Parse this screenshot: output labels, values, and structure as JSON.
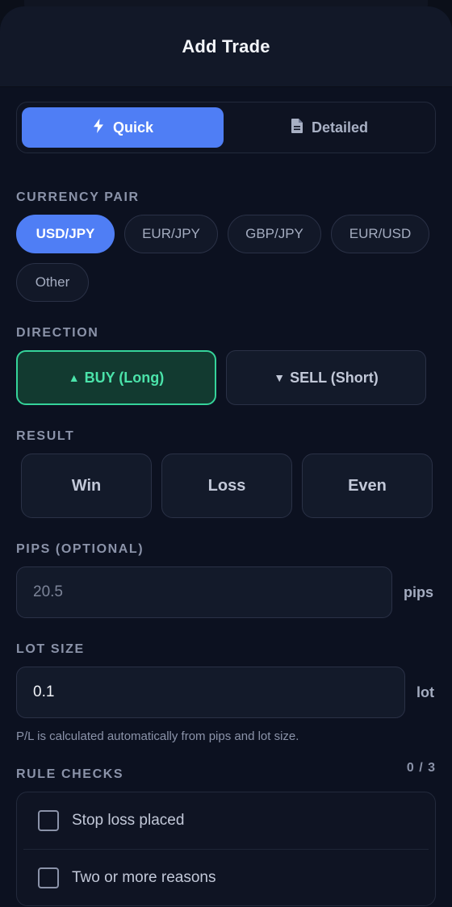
{
  "header": {
    "title": "Add Trade"
  },
  "mode_toggle": {
    "quick_label": "Quick",
    "detailed_label": "Detailed",
    "selected": "Quick"
  },
  "currency_pair": {
    "label": "CURRENCY PAIR",
    "options": [
      "USD/JPY",
      "EUR/JPY",
      "GBP/JPY",
      "EUR/USD",
      "Other"
    ],
    "selected": "USD/JPY"
  },
  "direction": {
    "label": "DIRECTION",
    "buy_label": "BUY (Long)",
    "sell_label": "SELL (Short)",
    "buy_arrow": "▲",
    "sell_arrow": "▼",
    "selected": "BUY (Long)"
  },
  "result": {
    "label": "RESULT",
    "options": [
      "Win",
      "Loss",
      "Even"
    ]
  },
  "pips": {
    "label": "PIPS (OPTIONAL)",
    "placeholder": "20.5",
    "unit": "pips"
  },
  "lot_size": {
    "label": "LOT SIZE",
    "value": "0.1",
    "unit": "lot"
  },
  "hint": "P/L is calculated automatically from pips and lot size.",
  "rules": {
    "label": "RULE CHECKS",
    "count": "0 / 3",
    "items": [
      "Stop loss placed",
      "Two or more reasons"
    ]
  },
  "colors": {
    "accent": "#4f7ef5",
    "buy_green": "#35d39a",
    "background": "#0c1120"
  }
}
